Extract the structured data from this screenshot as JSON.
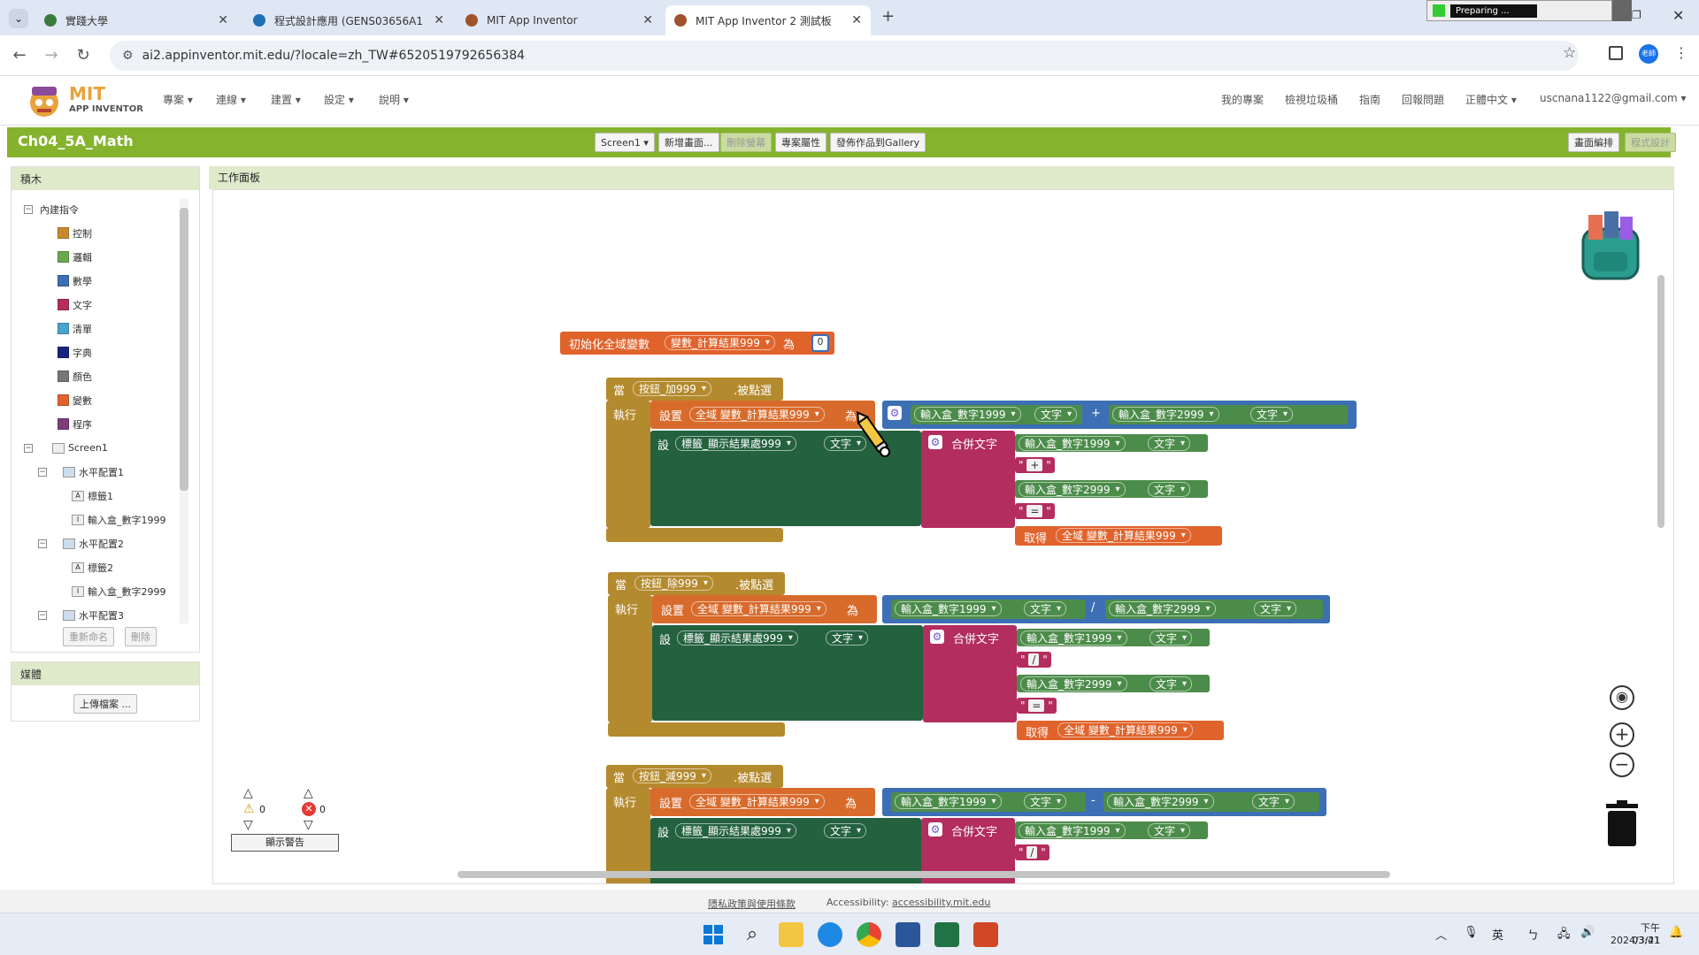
{
  "browser": {
    "tabs": [
      {
        "label": "實踐大學",
        "fav_color": "#3a7a3a"
      },
      {
        "label": "程式設計應用 (GENS03656A1",
        "fav_color": "#1f6fb5"
      },
      {
        "label": "MIT App Inventor",
        "fav_color": "#a0522d"
      },
      {
        "label": "MIT App Inventor 2 測試板",
        "fav_color": "#a0522d"
      }
    ],
    "url": "ai2.appinventor.mit.edu/?locale=zh_TW#6520519792656384",
    "preparing": "Preparing ...",
    "profile": "老師"
  },
  "app": {
    "logo_top": "MIT",
    "logo_bottom": "APP INVENTOR",
    "menus": [
      "專案 ▾",
      "連線 ▾",
      "建置 ▾",
      "設定 ▾",
      "說明 ▾"
    ],
    "right_menus": [
      "我的專案",
      "檢視垃圾桶",
      "指南",
      "回報問題",
      "正體中文 ▾"
    ],
    "user": "uscnana1122@gmail.com ▾"
  },
  "project": {
    "name": "Ch04_5A_Math",
    "screen_select": "Screen1 ▾",
    "buttons": [
      "新增畫面...",
      "刪除螢幕",
      "專案屬性",
      "發佈作品到Gallery"
    ],
    "right_buttons": [
      "畫面編排",
      "程式設計"
    ]
  },
  "palette": {
    "title": "積木",
    "builtin": "內建指令",
    "items": [
      {
        "label": "控制",
        "color": "#c88a2e"
      },
      {
        "label": "邏輯",
        "color": "#6aa84f"
      },
      {
        "label": "數學",
        "color": "#3d6fb4"
      },
      {
        "label": "文字",
        "color": "#b32d5e"
      },
      {
        "label": "清單",
        "color": "#4aa3c8"
      },
      {
        "label": "字典",
        "color": "#1a237e"
      },
      {
        "label": "顏色",
        "color": "#777777"
      },
      {
        "label": "變數",
        "color": "#e0632c"
      },
      {
        "label": "程序",
        "color": "#7b3f7b"
      }
    ],
    "screen": "Screen1",
    "components": [
      {
        "label": "水平配置1",
        "level": 1
      },
      {
        "label": "標籤1",
        "level": 2,
        "icon": "A"
      },
      {
        "label": "輸入盒_數字1999",
        "level": 2,
        "icon": "I"
      },
      {
        "label": "水平配置2",
        "level": 1
      },
      {
        "label": "標籤2",
        "level": 2,
        "icon": "A"
      },
      {
        "label": "輸入盒_數字2999",
        "level": 2,
        "icon": "I"
      },
      {
        "label": "水平配置3",
        "level": 1
      }
    ],
    "rename": "重新命名",
    "delete": "刪除"
  },
  "media": {
    "title": "媒體",
    "upload": "上傳檔案 ..."
  },
  "workspace": {
    "title": "工作面板",
    "warnings": "0",
    "errors": "0",
    "show_warnings": "顯示警告",
    "init": {
      "label": "初始化全域變數",
      "var": "變數_計算結果999",
      "as": "為",
      "value": "0"
    },
    "events": [
      {
        "when": "當",
        "button": "按鈕_加999",
        "clicked": ".被點選",
        "do": "執行",
        "set": "設置",
        "global_var": "全域 變數_計算結果999",
        "as": "為",
        "in1": "輸入盒_數字1999",
        "prop": "文字",
        "op": "+",
        "in2": "輸入盒_數字2999",
        "set2": "設",
        "label_comp": "標籤_顯示結果處999",
        "label_prop": "文字",
        "join": "合併文字",
        "str1": "+",
        "str2": "=",
        "get": "取得",
        "get_var": "全域 變數_計算結果999"
      },
      {
        "when": "當",
        "button": "按鈕_除999",
        "clicked": ".被點選",
        "do": "執行",
        "set": "設置",
        "global_var": "全域 變數_計算結果999",
        "as": "為",
        "in1": "輸入盒_數字1999",
        "prop": "文字",
        "op": "/",
        "in2": "輸入盒_數字2999",
        "set2": "設",
        "label_comp": "標籤_顯示結果處999",
        "label_prop": "文字",
        "join": "合併文字",
        "str1": "/",
        "str2": "=",
        "get": "取得",
        "get_var": "全域 變數_計算結果999"
      },
      {
        "when": "當",
        "button": "按鈕_減999",
        "clicked": ".被點選",
        "do": "執行",
        "set": "設置",
        "global_var": "全域 變數_計算結果999",
        "as": "為",
        "in1": "輸入盒_數字1999",
        "prop": "文字",
        "op": "-",
        "in2": "輸入盒_數字2999",
        "set2": "設",
        "label_comp": "標籤_顯示結果處999",
        "label_prop": "文字",
        "join": "合併文字",
        "str1": "/"
      }
    ]
  },
  "footer": {
    "privacy": "隱私政策與使用條款",
    "access_label": "Accessibility:",
    "access_link": "accessibility.mit.edu"
  },
  "taskbar": {
    "ime": "英",
    "time": "下午 03:41",
    "date": "2024/3/21"
  }
}
